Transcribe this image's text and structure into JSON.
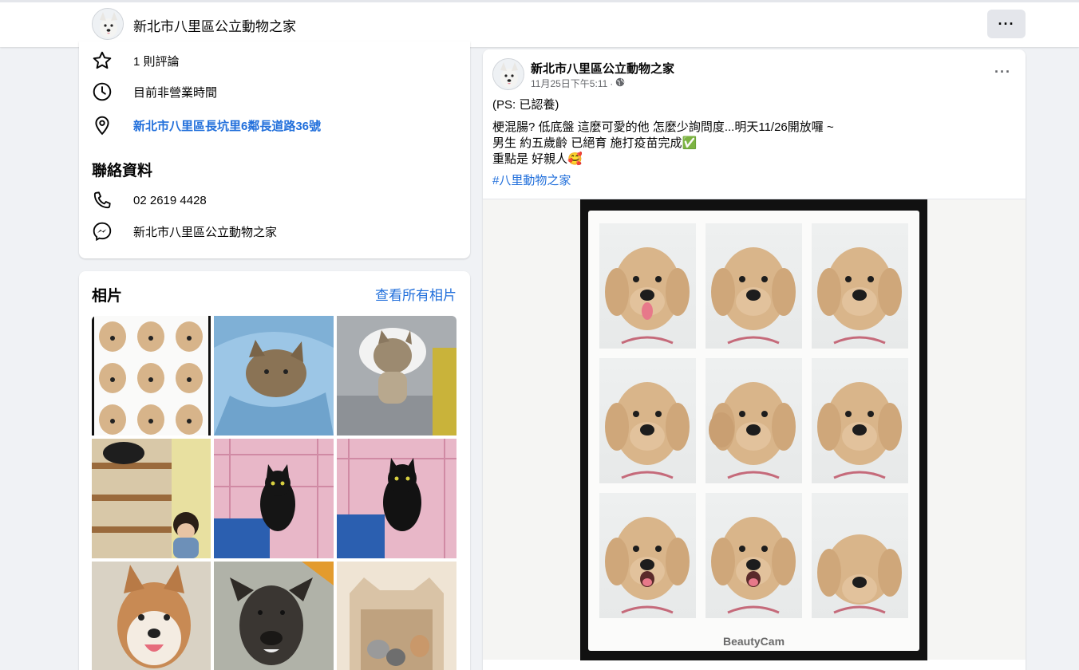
{
  "header": {
    "page_name": "新北市八里區公立動物之家",
    "more_label": "···"
  },
  "intro": {
    "reviews": "1 則評論",
    "hours": "目前非營業時間",
    "address": "新北市八里區長坑里6鄰長道路36號",
    "contact_title": "聯絡資料",
    "phone": "02 2619 4428",
    "messenger": "新北市八里區公立動物之家"
  },
  "photos": {
    "title": "相片",
    "see_all": "查看所有相片",
    "items": [
      "dog-collage",
      "kitten-in-towel",
      "cat-with-cone",
      "cats-and-child",
      "black-cat-in-cage",
      "black-cat-in-cage-2",
      "shiba-dog",
      "black-dog",
      "kittens-in-bed"
    ]
  },
  "post": {
    "author": "新北市八里區公立動物之家",
    "time": "11月25日下午5:11",
    "separator": "·",
    "line1": "(PS: 已認養)",
    "line2": "梗混腸? 低底盤 這麼可愛的他 怎麼少詢問度...明天11/26開放囉 ~",
    "line3": "男生 約五歲齡  已絕育 施打疫苗完成✅",
    "line4": "重點是 好親人🥰",
    "hashtag": "#八里動物之家",
    "more_label": "···",
    "photo_brand": "BeautyCam"
  },
  "colors": {
    "link": "#216fdb",
    "bg": "#f0f2f5",
    "secondary_text": "#65676b"
  }
}
